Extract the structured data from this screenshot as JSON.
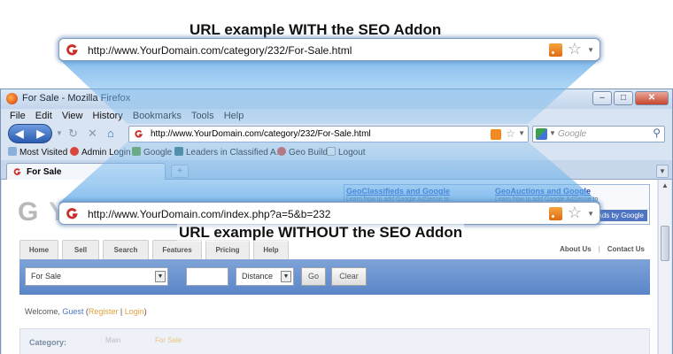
{
  "top_caption": "URL example WITH the SEO Addon",
  "top_url": "http://www.YourDomain.com/category/232/For-Sale.html",
  "bottom_caption": "URL example WITHOUT the SEO Addon",
  "bottom_url": "http://www.YourDomain.com/index.php?a=5&b=232",
  "browser": {
    "title": "For Sale - Mozilla Firefox",
    "menu": [
      "File",
      "Edit",
      "View",
      "History",
      "Bookmarks",
      "Tools",
      "Help"
    ],
    "address": "http://www.YourDomain.com/category/232/For-Sale.html",
    "search_placeholder": "Google",
    "bookmarks": [
      "Most Visited",
      "Admin Login",
      "Google",
      "Leaders in Classified A...",
      "Geo Build",
      "Logout"
    ],
    "tab_label": "For Sale",
    "new_tab": "+"
  },
  "page": {
    "logo_text": "Y",
    "ads": {
      "link1": "GeoClassifieds and Google",
      "desc1": "Learn how to add Google AdSense to",
      "link2": "GeoAuctions and Google",
      "desc2": "Learn how to add Google AdSense to",
      "badge": "Ads by Google"
    },
    "nav_tabs": [
      "Home",
      "Sell",
      "Search",
      "Features",
      "Pricing",
      "Help"
    ],
    "about": "About Us",
    "sep": "|",
    "contact": "Contact Us",
    "search_category": "For Sale",
    "search_distance": "Distance",
    "go": "Go",
    "clear": "Clear",
    "welcome_prefix": "Welcome,",
    "guest": "Guest",
    "register": "Register",
    "login": "Login",
    "category_label": "Category:",
    "crumb_main": "Main",
    "crumb_sale": "For Sale"
  },
  "colors": {
    "accent": "#5a85c8",
    "beam": "#7ab0e0",
    "rss": "#f08a24"
  }
}
